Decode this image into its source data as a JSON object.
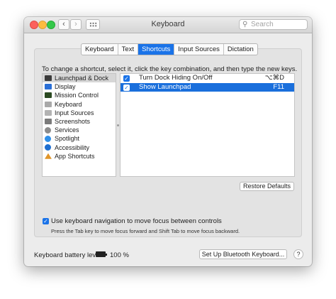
{
  "window": {
    "title": "Keyboard"
  },
  "toolbar": {
    "search_placeholder": "Search",
    "back_glyph": "‹",
    "forward_glyph": "›"
  },
  "tabs": [
    {
      "label": "Keyboard",
      "active": false
    },
    {
      "label": "Text",
      "active": false
    },
    {
      "label": "Shortcuts",
      "active": true
    },
    {
      "label": "Input Sources",
      "active": false
    },
    {
      "label": "Dictation",
      "active": false
    }
  ],
  "instruction": "To change a shortcut, select it, click the key combination, and then type the new keys.",
  "categories": [
    {
      "label": "Launchpad & Dock",
      "icon": "launchpad-dock-icon",
      "color": "#3b3b3b",
      "selected": true
    },
    {
      "label": "Display",
      "icon": "display-icon",
      "color": "#2a6fd6",
      "selected": false
    },
    {
      "label": "Mission Control",
      "icon": "mission-control-icon",
      "color": "#2b4a22",
      "selected": false
    },
    {
      "label": "Keyboard",
      "icon": "keyboard-icon",
      "color": "#a9a9a9",
      "selected": false
    },
    {
      "label": "Input Sources",
      "icon": "input-sources-icon",
      "color": "#b3b3b3",
      "selected": false
    },
    {
      "label": "Screenshots",
      "icon": "screenshots-icon",
      "color": "#7b7b7b",
      "selected": false
    },
    {
      "label": "Services",
      "icon": "services-gear-icon",
      "color": "#8c8c8c",
      "selected": false
    },
    {
      "label": "Spotlight",
      "icon": "spotlight-icon",
      "color": "#2f8fe8",
      "selected": false
    },
    {
      "label": "Accessibility",
      "icon": "accessibility-icon",
      "color": "#1f6fd0",
      "selected": false
    },
    {
      "label": "App Shortcuts",
      "icon": "app-shortcuts-icon",
      "color": "#e0952a",
      "selected": false
    }
  ],
  "shortcuts": [
    {
      "label": "Turn Dock Hiding On/Off",
      "key": "⌥⌘D",
      "checked": true,
      "selected": false
    },
    {
      "label": "Show Launchpad",
      "key": "F11",
      "checked": true,
      "selected": true
    }
  ],
  "buttons": {
    "restore_defaults": "Restore Defaults",
    "bluetooth": "Set Up Bluetooth Keyboard...",
    "help": "?"
  },
  "keyboard_nav": {
    "label": "Use keyboard navigation to move focus between controls",
    "hint": "Press the Tab key to move focus forward and Shift Tab to move focus backward.",
    "checked": true
  },
  "battery": {
    "label": "Keyboard battery level:",
    "value": "100 %"
  },
  "colors": {
    "accent": "#1a73e8",
    "selection": "#1a6fdc"
  }
}
